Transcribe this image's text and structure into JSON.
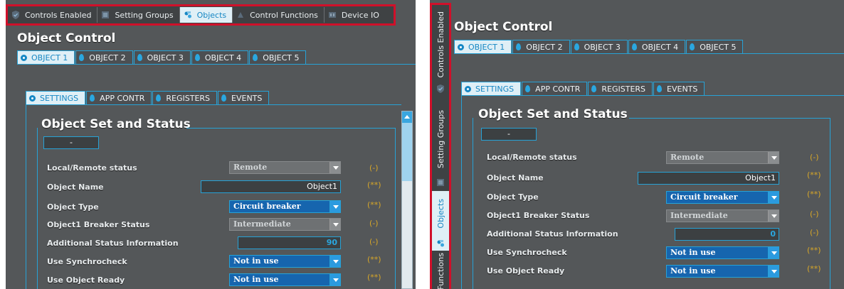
{
  "nav": {
    "tabs": [
      "Controls Enabled",
      "Setting Groups",
      "Objects",
      "Control Functions",
      "Device IO"
    ],
    "side_tabs": [
      "Controls Enabled",
      "Setting Groups",
      "Objects",
      "Functions"
    ]
  },
  "header": {
    "title": "Object Control"
  },
  "object_tabs": [
    "OBJECT 1",
    "OBJECT 2",
    "OBJECT 3",
    "OBJECT 4",
    "OBJECT 5"
  ],
  "sub_tabs": [
    "SETTINGS",
    "APP CONTR",
    "REGISTERS",
    "EVENTS"
  ],
  "section": {
    "title": "Object Set and Status",
    "button_label": "-"
  },
  "left_rows": [
    {
      "label": "Local/Remote status",
      "value": "Remote",
      "status": "(-)"
    },
    {
      "label": "Object Name",
      "value": "Object1",
      "status": "(**)"
    },
    {
      "label": "Object Type",
      "value": "Circuit breaker",
      "status": "(**)"
    },
    {
      "label": "Object1 Breaker Status",
      "value": "Intermediate",
      "status": "(-)"
    },
    {
      "label": "Additional Status Information",
      "value": "90",
      "status": "(-)"
    },
    {
      "label": "Use Synchrocheck",
      "value": "Not in use",
      "status": "(**)"
    },
    {
      "label": "Use Object Ready",
      "value": "Not in use",
      "status": "(**)"
    }
  ],
  "right_rows": [
    {
      "label": "Local/Remote status",
      "value": "Remote",
      "status": "(-)"
    },
    {
      "label": "Object Name",
      "value": "Object1",
      "status": "(**)"
    },
    {
      "label": "Object Type",
      "value": "Circuit breaker",
      "status": "(**)"
    },
    {
      "label": "Object1 Breaker Status",
      "value": "Intermediate",
      "status": "(-)"
    },
    {
      "label": "Additional Status Information",
      "value": "0",
      "status": "(-)"
    },
    {
      "label": "Use Synchrocheck",
      "value": "Not in use",
      "status": "(**)"
    },
    {
      "label": "Use Object Ready",
      "value": "Not in use",
      "status": "(**)"
    }
  ],
  "colors": {
    "highlight_border": "#d0102a",
    "accent": "#27a2d6",
    "status": "#d8a728"
  }
}
